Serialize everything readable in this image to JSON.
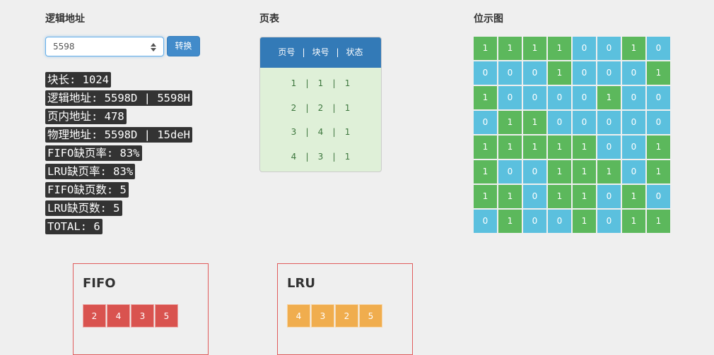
{
  "logical_address": {
    "title": "逻辑地址",
    "input_value": "5598",
    "convert_label": "转换"
  },
  "info": [
    "块长: 1024",
    "逻辑地址: 5598D | 5598H",
    "页内地址: 478",
    "物理地址: 5598D | 15deH",
    "FIFO缺页率: 83%",
    "LRU缺页率: 83%",
    "FIFO缺页数: 5",
    "LRU缺页数: 5",
    "TOTAL: 6"
  ],
  "page_table": {
    "title": "页表",
    "headers": [
      "页号",
      "块号",
      "状态"
    ],
    "separator": "|",
    "rows": [
      [
        "1",
        "1",
        "1"
      ],
      [
        "2",
        "2",
        "1"
      ],
      [
        "3",
        "4",
        "1"
      ],
      [
        "4",
        "3",
        "1"
      ]
    ]
  },
  "bitmap": {
    "title": "位示图",
    "one_color": "#5cb85c",
    "zero_color": "#5bc0de",
    "rows": [
      [
        "1",
        "1",
        "1",
        "1",
        "0",
        "0",
        "1",
        "0"
      ],
      [
        "0",
        "0",
        "0",
        "1",
        "0",
        "0",
        "0",
        "1"
      ],
      [
        "1",
        "0",
        "0",
        "0",
        "0",
        "1",
        "0",
        "0"
      ],
      [
        "0",
        "1",
        "1",
        "0",
        "0",
        "0",
        "0",
        "0"
      ],
      [
        "1",
        "1",
        "1",
        "1",
        "1",
        "0",
        "0",
        "1"
      ],
      [
        "1",
        "0",
        "0",
        "1",
        "1",
        "1",
        "0",
        "1"
      ],
      [
        "1",
        "1",
        "0",
        "1",
        "1",
        "0",
        "1",
        "0"
      ],
      [
        "0",
        "1",
        "0",
        "0",
        "1",
        "0",
        "1",
        "1"
      ]
    ]
  },
  "fifo": {
    "title": "FIFO",
    "color": "#d9534f",
    "blocks": [
      "2",
      "4",
      "3",
      "5"
    ]
  },
  "lru": {
    "title": "LRU",
    "color": "#f0ad4e",
    "blocks": [
      "4",
      "3",
      "2",
      "5"
    ]
  },
  "colors": {
    "panel_border": "#e05c5c",
    "table_header": "#337ab7",
    "table_body": "#dff0d8",
    "button": "#428bca"
  }
}
